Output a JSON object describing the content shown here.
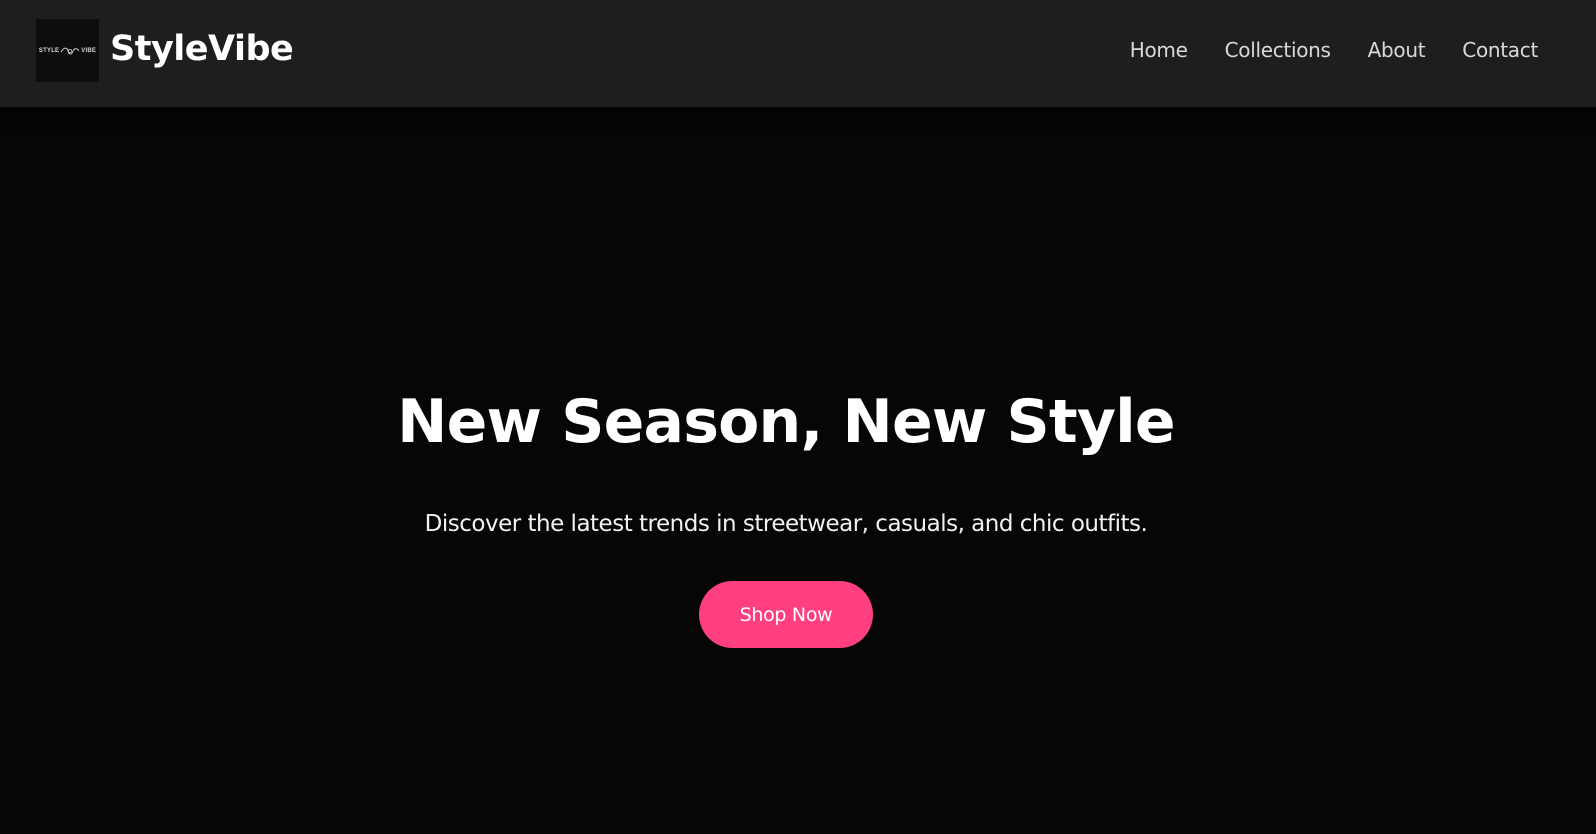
{
  "header": {
    "logo_text_left": "STYLE",
    "logo_text_right": "VIBE",
    "brand": "StyleVibe",
    "nav": [
      {
        "label": "Home"
      },
      {
        "label": "Collections"
      },
      {
        "label": "About"
      },
      {
        "label": "Contact"
      }
    ]
  },
  "hero": {
    "title": "New Season, New Style",
    "subtitle": "Discover the latest trends in streetwear, casuals, and chic outfits.",
    "cta_label": "Shop Now"
  },
  "colors": {
    "navbar_bg": "#1e1e1e",
    "page_bg": "#060606",
    "accent": "#ff3f7f",
    "text": "#ffffff"
  }
}
